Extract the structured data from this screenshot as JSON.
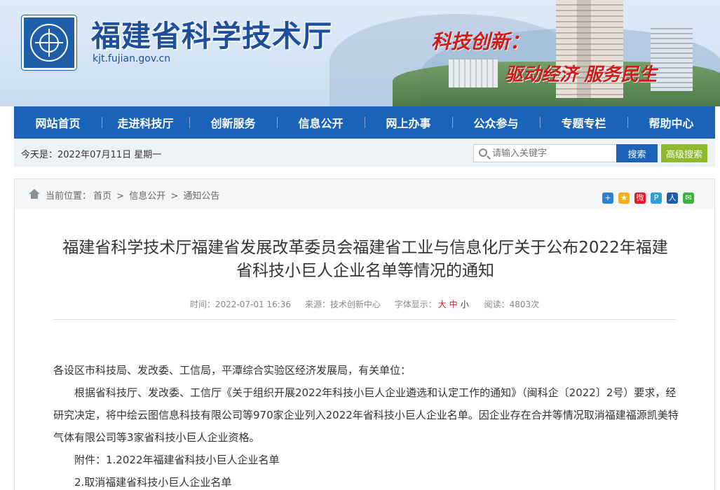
{
  "header": {
    "site_title": "福建省科学技术厅",
    "domain": "kjt.fujian.gov.cn",
    "slogan_line1": "科技创新：",
    "slogan_line2": "驱动经济 服务民生"
  },
  "nav": {
    "items": [
      "网站首页",
      "走进科技厅",
      "创新服务",
      "信息公开",
      "网上办事",
      "公众参与",
      "专题专栏",
      "帮助中心"
    ]
  },
  "infobar": {
    "today": "今天是：2022年07月11日   星期一",
    "search_placeholder": "请输入关键字",
    "search_label": "搜索",
    "advanced_label": "高级搜索"
  },
  "breadcrumb": {
    "prefix": "当前位置：",
    "items": [
      "首页",
      "信息公开",
      "通知公告"
    ],
    "separator": ">"
  },
  "article": {
    "title": "福建省科学技术厅福建省发展改革委员会福建省工业与信息化厅关于公布2022年福建省科技小巨人企业名单等情况的通知",
    "time": "时间：2022-07-01 16:36",
    "source": "来源：技术创新中心",
    "font_label": "字体显示：",
    "font_large": "大",
    "font_medium": "中",
    "font_small": "小",
    "reads": "阅读：4803次",
    "salutation": "各设区市科技局、发改委、工信局，平潭综合实验区经济发展局，有关单位：",
    "paragraph": "根据省科技厅、发改委、工信厅《关于组织开展2022年科技小巨人企业遴选和认定工作的通知》（闽科企〔2022〕2号）要求，经研究决定，将中绘云图信息科技有限公司等970家企业列入2022年省科技小巨人企业名单。因企业存在合并等情况取消福建福源凯美特气体有限公司等3家省科技小巨人企业资格。",
    "attachment1": "附件：1.2022年福建省科技小巨人企业名单",
    "attachment2": "2.取消福建省科技小巨人企业名单"
  },
  "share_icons": [
    {
      "name": "share-more-icon",
      "color": "#2d7fd4",
      "glyph": "+"
    },
    {
      "name": "share-qzone-icon",
      "color": "#f2b01e",
      "glyph": "★"
    },
    {
      "name": "share-weibo-icon",
      "color": "#e6162d",
      "glyph": "微"
    },
    {
      "name": "share-tencent-weibo-icon",
      "color": "#2b9fd9",
      "glyph": "P"
    },
    {
      "name": "share-renren-icon",
      "color": "#1d5bab",
      "glyph": "人"
    },
    {
      "name": "share-wechat-icon",
      "color": "#3db33f",
      "glyph": "✉"
    }
  ]
}
